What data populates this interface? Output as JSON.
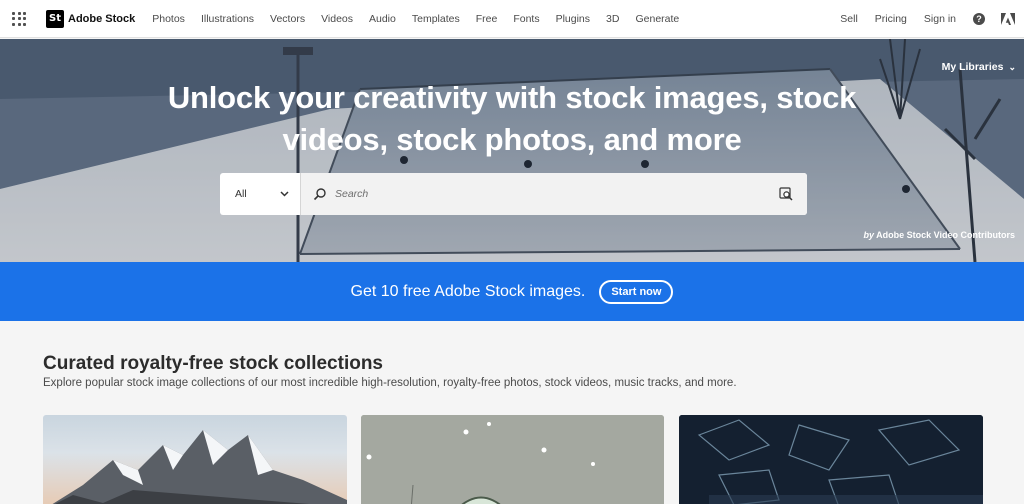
{
  "nav": {
    "logo_badge": "St",
    "logo_text": "Adobe Stock",
    "items": [
      "Photos",
      "Illustrations",
      "Vectors",
      "Videos",
      "Audio",
      "Templates",
      "Free",
      "Fonts",
      "Plugins",
      "3D",
      "Generate"
    ],
    "right": {
      "sell": "Sell",
      "pricing": "Pricing",
      "sign_in": "Sign in",
      "help": "?"
    }
  },
  "hero": {
    "title_line1": "Unlock your creativity with stock images, stock",
    "title_line2": "videos, stock photos, and more",
    "my_libraries": "My Libraries",
    "credit_by": "by",
    "credit_name": "Adobe Stock Video Contributors",
    "search": {
      "type_value": "All",
      "placeholder": "Search"
    }
  },
  "promo": {
    "text": "Get 10 free Adobe Stock images.",
    "button": "Start now"
  },
  "collections": {
    "title": "Curated royalty-free stock collections",
    "subtitle": "Explore popular stock image collections of our most incredible high-resolution, royalty-free photos, stock videos, music tracks, and more."
  },
  "colors": {
    "promo_blue": "#1b72e8",
    "page_bg": "#f5f5f5"
  }
}
